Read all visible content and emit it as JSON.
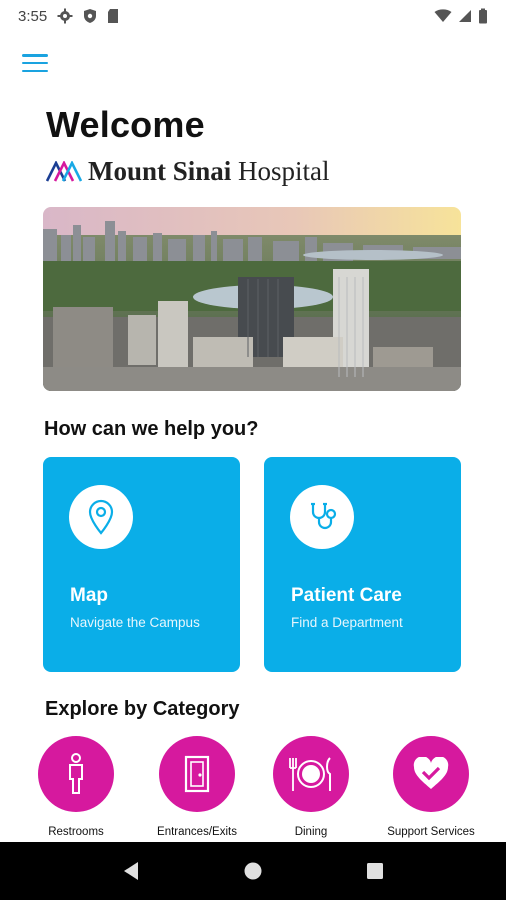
{
  "status_bar": {
    "time": "3:55"
  },
  "header": {
    "welcome": "Welcome"
  },
  "brand": {
    "name_bold": "Mount Sinai",
    "name_regular": "Hospital"
  },
  "help_section": {
    "title": "How can we help you?",
    "cards": [
      {
        "title": "Map",
        "subtitle": "Navigate the Campus",
        "icon": "location-pin-icon"
      },
      {
        "title": "Patient Care",
        "subtitle": "Find a Department",
        "icon": "stethoscope-icon"
      }
    ]
  },
  "explore_section": {
    "title": "Explore by Category",
    "categories": [
      {
        "label": "Restrooms",
        "icon": "restroom-icon"
      },
      {
        "label": "Entrances/Exits",
        "icon": "door-icon"
      },
      {
        "label": "Dining",
        "icon": "dining-icon"
      },
      {
        "label": "Support Services",
        "icon": "heart-check-icon"
      }
    ]
  },
  "colors": {
    "accent_blue": "#0aaee8",
    "category_magenta": "#d6199e",
    "menu_blue": "#1aa3e0"
  }
}
